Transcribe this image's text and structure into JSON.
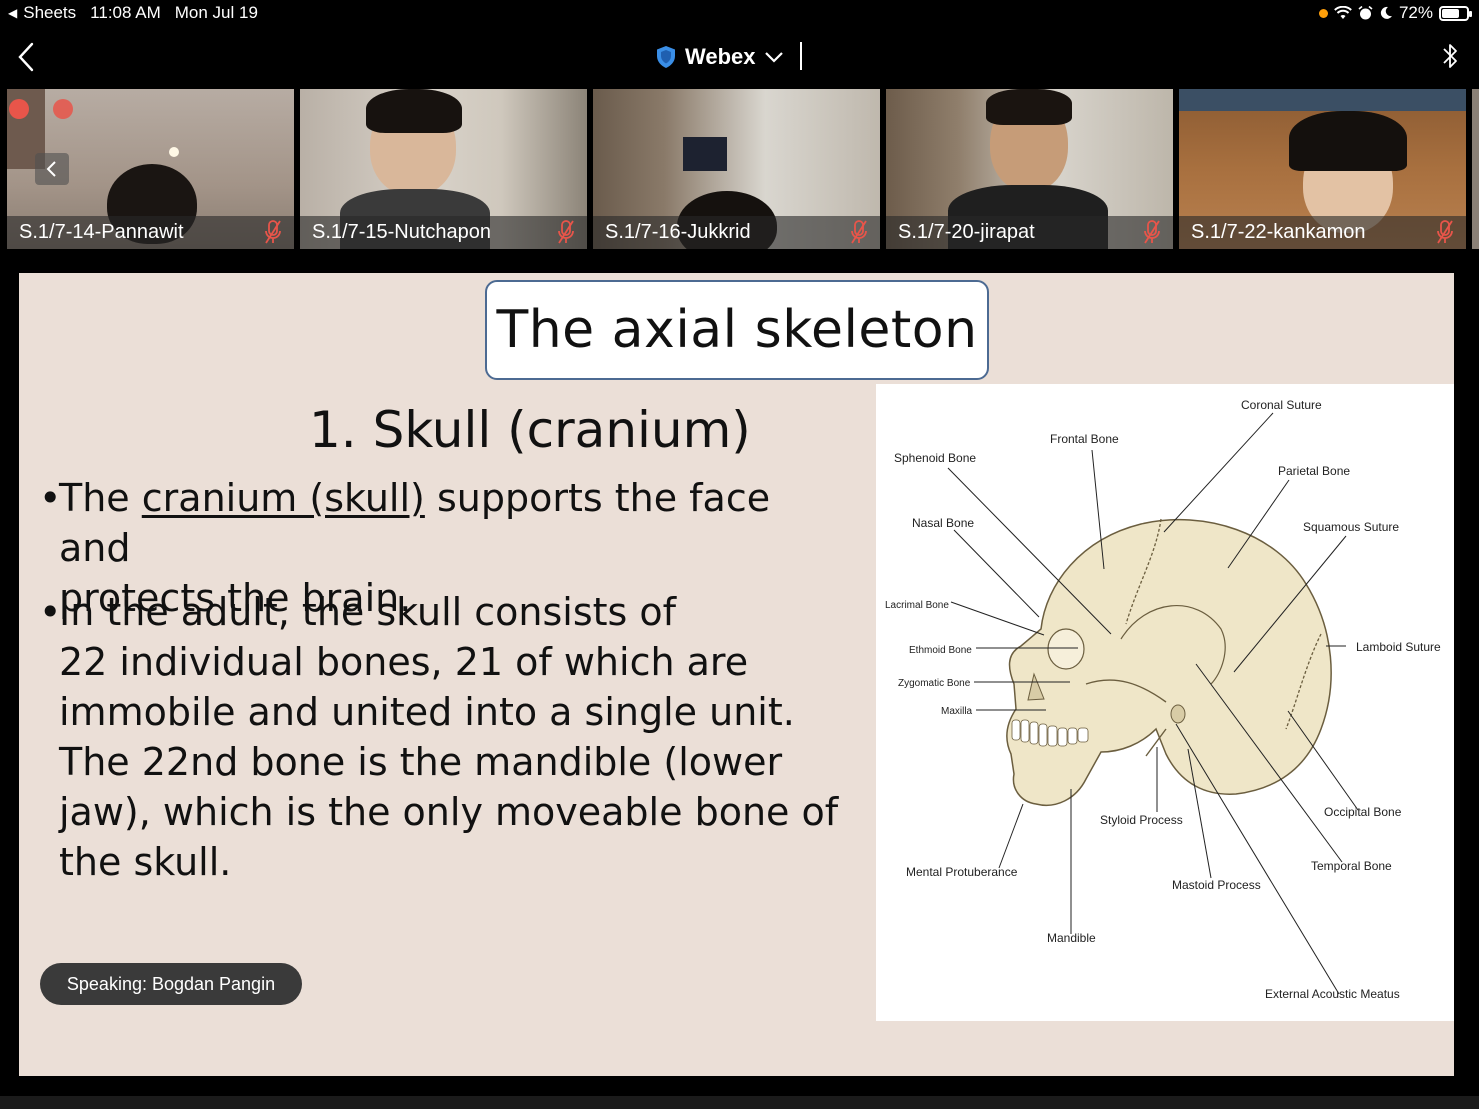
{
  "status_bar": {
    "back_app": "Sheets",
    "time": "11:08 AM",
    "date": "Mon Jul 19",
    "battery": "72%",
    "battery_level": 0.72
  },
  "nav": {
    "app_title": "Webex"
  },
  "participants": [
    {
      "name": "S.1/7-14-Pannawit",
      "muted": true
    },
    {
      "name": "S.1/7-15-Nutchapon",
      "muted": true
    },
    {
      "name": "S.1/7-16-Jukkrid",
      "muted": true
    },
    {
      "name": "S.1/7-20-jirapat",
      "muted": true
    },
    {
      "name": "S.1/7-22-kankamon",
      "muted": true
    }
  ],
  "slide": {
    "title": "The axial skeleton",
    "subtitle": "1. Skull (cranium)",
    "bullet1": {
      "pre": "The ",
      "underlined": "cranium (skull)",
      "line1_post": " supports the face and",
      "line2": "protects the brain."
    },
    "bullet2_lines": [
      "In the adult, the skull consists of",
      "22 individual bones, 21 of which are",
      "immobile and united into a single unit.",
      "The 22nd bone is the mandible (lower",
      "jaw), which is the only moveable bone of",
      "the skull."
    ],
    "diagram_labels": {
      "coronal_suture": "Coronal Suture",
      "frontal_bone": "Frontal Bone",
      "sphenoid_bone": "Sphenoid Bone",
      "parietal_bone": "Parietal Bone",
      "nasal_bone": "Nasal Bone",
      "squamous_suture": "Squamous Suture",
      "lacrimal_bone": "Lacrimal Bone",
      "ethmoid_bone": "Ethmoid Bone",
      "lamboid_suture": "Lamboid Suture",
      "zygomatic_bone": "Zygomatic Bone",
      "maxilla": "Maxilla",
      "occipital_bone": "Occipital Bone",
      "styloid_process": "Styloid Process",
      "temporal_bone": "Temporal Bone",
      "mental_protuberance": "Mental Protuberance",
      "mastoid_process": "Mastoid Process",
      "mandible": "Mandible",
      "external_acoustic_meatus": "External Acoustic Meatus"
    }
  },
  "speaking": "Speaking: Bogdan Pangin",
  "colors": {
    "slide_bg": "#ebdfd7",
    "title_border": "#4c6a92",
    "bone": "#efe6c8",
    "webex_shield": "#3a8ee6",
    "mute_red": "#e8554a"
  }
}
